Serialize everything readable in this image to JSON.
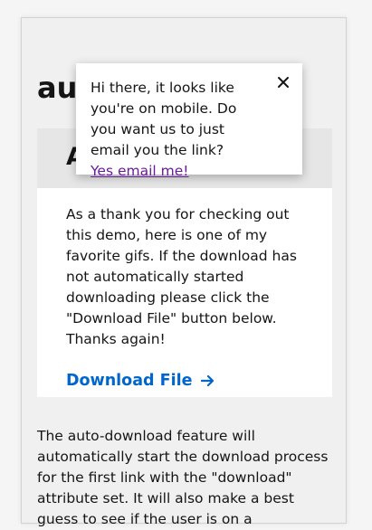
{
  "page": {
    "title": "auto-download"
  },
  "card": {
    "title": "A",
    "body": "As a thank you for checking out this demo, here is one of my favorite gifs. If the download has not automatically started downloading please click the \"Download File\" button below. Thanks again!",
    "download_label": "Download File",
    "download_icon": "arrow-right-icon"
  },
  "description": {
    "text": "The auto-download feature will automatically start the download process for the first link with the \"download\" attribute set. It will also make a best guess to see if the user is on a"
  },
  "popup": {
    "message": "Hi there, it looks like you're on mobile. Do you want us to just email you the link?",
    "link_label": "Yes email me!",
    "close_icon": "close-icon"
  },
  "colors": {
    "link_blue": "#0066cc",
    "visited_purple": "#6a1b9a",
    "card_header_gray": "#e6e6e6",
    "frame_gray": "#f0f0f0"
  }
}
